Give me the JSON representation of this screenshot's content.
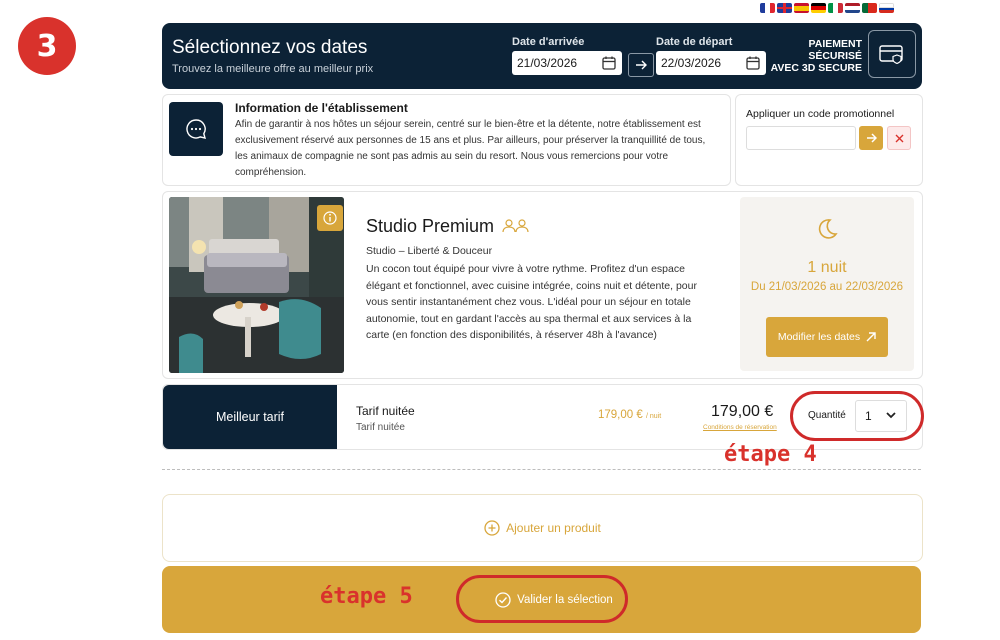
{
  "annotations": {
    "step_number": "3",
    "step4_label": "étape 4",
    "step5_label": "étape 5",
    "ring_color": "#cf2a2a"
  },
  "languages": [
    "fr",
    "en",
    "es",
    "de",
    "it",
    "nl",
    "pt",
    "ru"
  ],
  "header": {
    "title": "Sélectionnez vos dates",
    "subtitle": "Trouvez la meilleure offre au meilleur prix",
    "arrival_label": "Date d'arrivée",
    "arrival_value": "21/03/2026",
    "departure_label": "Date de départ",
    "departure_value": "22/03/2026",
    "secure_line1": "PAIEMENT",
    "secure_line2": "SÉCURISÉ",
    "secure_line3": "AVEC 3D SECURE",
    "bg_color": "#0c2236"
  },
  "info": {
    "title": "Information de l'établissement",
    "text": "Afin de garantir à nos hôtes un séjour serein, centré sur le bien-être et la détente, notre établissement est exclusivement réservé aux personnes de 15 ans et plus. Par ailleurs, pour préserver la tranquillité de tous, les animaux de compagnie ne sont pas admis au sein du resort. Nous vous remercions pour votre compréhension."
  },
  "promo": {
    "label": "Appliquer un code promotionnel",
    "value": "",
    "placeholder": ""
  },
  "room": {
    "name": "Studio Premium",
    "subtitle": "Studio – Liberté & Douceur",
    "description": "Un cocon tout équipé pour vivre à votre rythme. Profitez d'un espace élégant et fonctionnel, avec cuisine intégrée, coins nuit et détente, pour vous sentir instantanément chez vous. L'idéal pour un séjour en totale autonomie, tout en gardant l'accès au spa thermal et aux services à la carte (en fonction des disponibilités, à réserver 48h à l'avance)",
    "nights": "1 nuit",
    "date_range": "Du 21/03/2026 au 22/03/2026",
    "modify_label": "Modifier les dates"
  },
  "rate": {
    "badge": "Meilleur tarif",
    "name": "Tarif nuitée",
    "sub": "Tarif nuitée",
    "per_night": "179,00 €",
    "per_night_unit": "/ nuit",
    "total": "179,00 €",
    "conditions": "Conditions de réservation",
    "quantity_label": "Quantité",
    "quantity_value": "1"
  },
  "add_product_label": "Ajouter un produit",
  "validate_label": "Valider la sélection",
  "accent_color": "#d8a63b"
}
